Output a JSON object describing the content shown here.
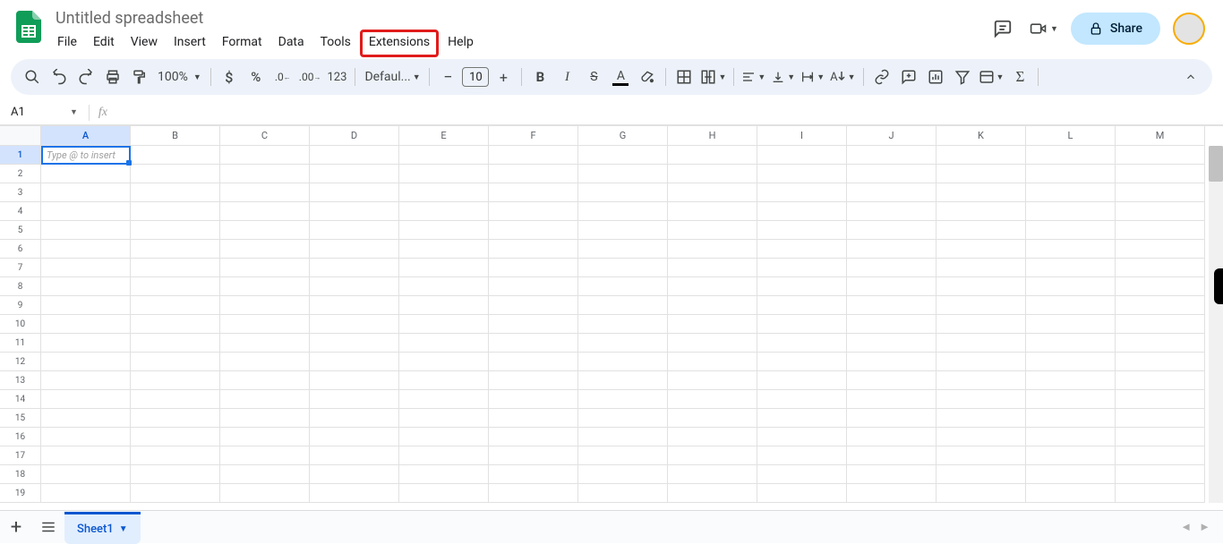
{
  "doc_title": "Untitled spreadsheet",
  "menus": [
    "File",
    "Edit",
    "View",
    "Insert",
    "Format",
    "Data",
    "Tools",
    "Extensions",
    "Help"
  ],
  "highlighted_menu_index": 7,
  "share_label": "Share",
  "toolbar": {
    "zoom": "100%",
    "currency_format": "123",
    "font_name": "Defaul...",
    "font_size": "10"
  },
  "namebox": {
    "cell_ref": "A1"
  },
  "active_cell_placeholder": "Type @ to insert",
  "columns": [
    "A",
    "B",
    "C",
    "D",
    "E",
    "F",
    "G",
    "H",
    "I",
    "J",
    "K",
    "L",
    "M"
  ],
  "selected_column": "A",
  "rows": [
    1,
    2,
    3,
    4,
    5,
    6,
    7,
    8,
    9,
    10,
    11,
    12,
    13,
    14,
    15,
    16,
    17,
    18,
    19
  ],
  "selected_row": 1,
  "sheet_tab": "Sheet1"
}
